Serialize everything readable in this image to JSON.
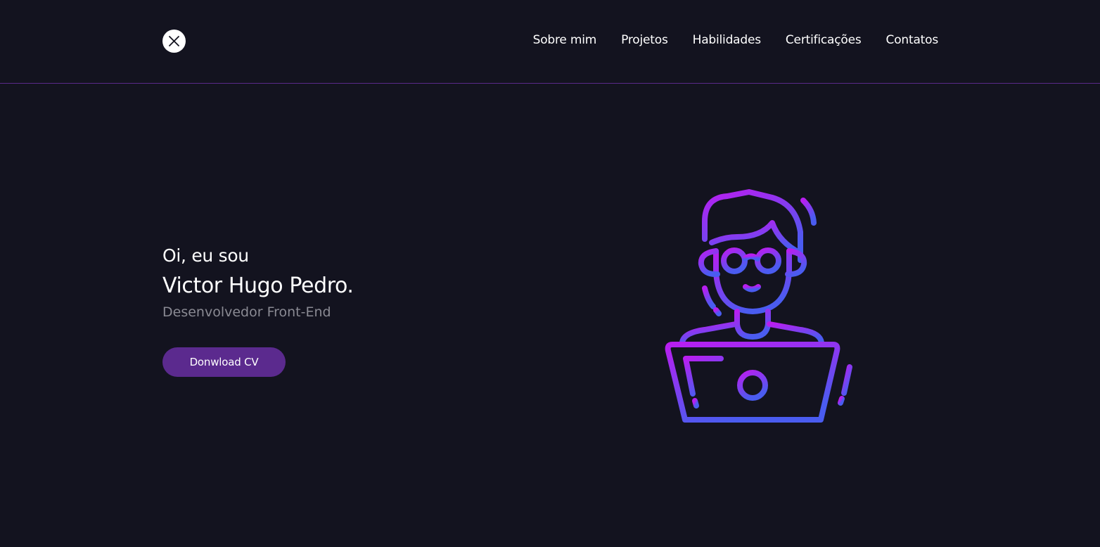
{
  "header": {
    "logo_icon": "close-icon",
    "nav": [
      {
        "label": "Sobre mim"
      },
      {
        "label": "Projetos"
      },
      {
        "label": "Habilidades"
      },
      {
        "label": "Certificações"
      },
      {
        "label": "Contatos"
      }
    ]
  },
  "hero": {
    "greeting": "Oi, eu sou",
    "name": "Victor Hugo Pedro.",
    "role": "Desenvolvedor Front-End",
    "cv_button_label": "Donwload CV",
    "illustration_icon": "developer-at-laptop-icon"
  },
  "colors": {
    "background": "#13131f",
    "header_border": "#5a2a8a",
    "button": "#5b2a8e",
    "gradient_top": "#b91ef0",
    "gradient_bottom": "#4a5cf0",
    "subtitle": "#8a8a93"
  }
}
